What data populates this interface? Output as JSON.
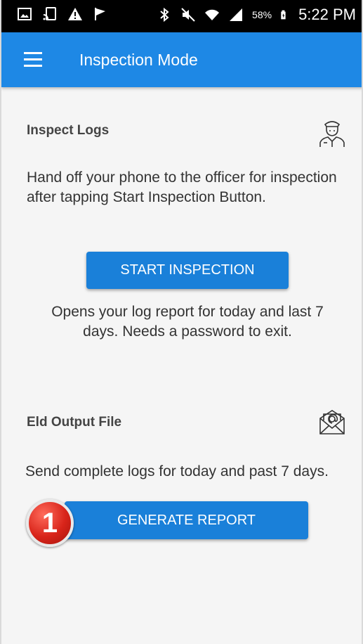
{
  "status_bar": {
    "battery_percent": "58%",
    "time": "5:22 PM",
    "icons": [
      "gallery-icon",
      "cast-icon",
      "warning-icon",
      "flag-icon",
      "bluetooth-icon",
      "mute-icon",
      "wifi-icon",
      "signal-icon",
      "battery-icon"
    ]
  },
  "app_bar": {
    "title": "Inspection Mode",
    "color": "#1e88e5"
  },
  "inspect_logs": {
    "title": "Inspect Logs",
    "description": "Hand off your phone to the officer for inspection after tapping Start Inspection Button.",
    "button_label": "START INSPECTION",
    "note": "Opens your log report for today and last 7 days. Needs a password to exit.",
    "icon": "officer-icon"
  },
  "eld_output": {
    "title": "Eld Output File",
    "description": "Send complete logs for today and past 7 days.",
    "button_label": "GENERATE REPORT",
    "badge": "1",
    "icon": "email-icon"
  },
  "colors": {
    "accent": "#1a80d9",
    "background": "#f5f5f5",
    "badge_red": "#d8241a"
  }
}
